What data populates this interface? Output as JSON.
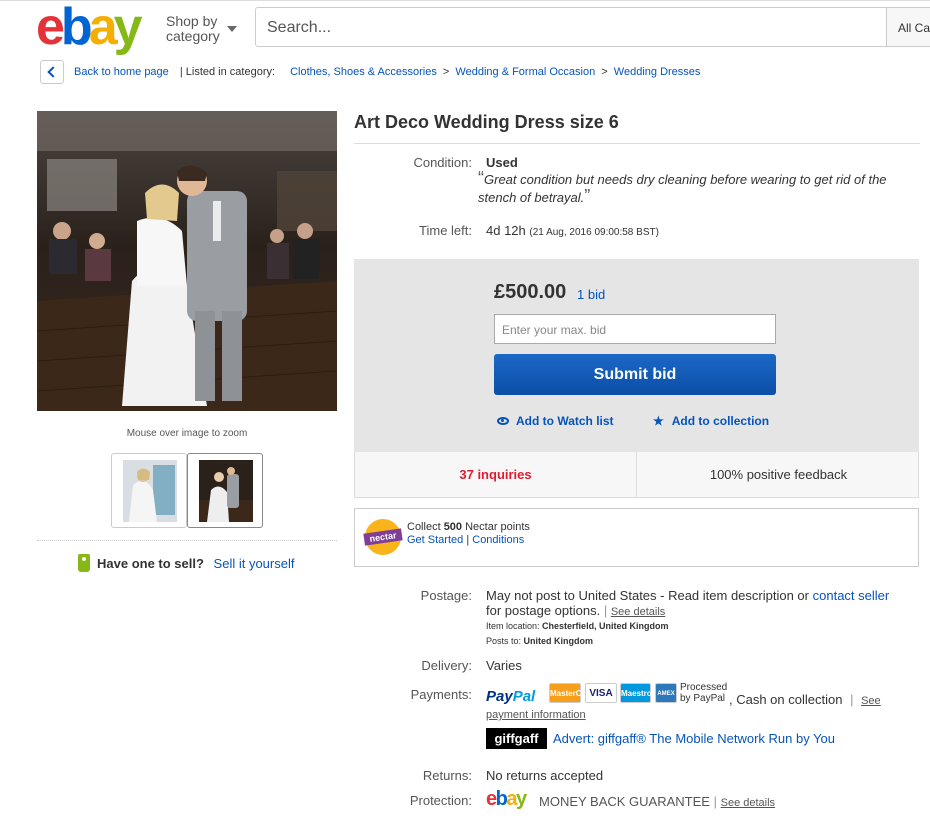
{
  "header": {
    "logo": {
      "e": "e",
      "b": "b",
      "a": "a",
      "y": "y"
    },
    "shop_by_line1": "Shop by",
    "shop_by_line2": "category",
    "search_placeholder": "Search...",
    "category_select": "All Ca"
  },
  "breadcrumb": {
    "back": "Back to home page",
    "listed_in": "| Listed in category:",
    "items": [
      "Clothes, Shoes & Accessories",
      "Wedding & Formal Occasion",
      "Wedding Dresses"
    ],
    "sep": ">"
  },
  "gallery": {
    "zoom_note": "Mouse over image to zoom"
  },
  "sell": {
    "question": "Have one to sell?",
    "link": "Sell it yourself"
  },
  "item": {
    "title": "Art Deco Wedding Dress size 6",
    "condition_label": "Condition:",
    "condition_value": "Used",
    "condition_quote": "Great condition but needs dry cleaning before wearing to get rid of the stench of betrayal.",
    "quote_open": "“",
    "quote_close": "”",
    "time_left_label": "Time left:",
    "time_left_value": "4d 12h",
    "time_left_detail": "(21 Aug, 2016   09:00:58 BST)"
  },
  "bid": {
    "price": "£500.00",
    "bids": "1 bid",
    "input_placeholder": "Enter your max. bid",
    "submit": "Submit bid",
    "watch": "Add to Watch list",
    "collection": "Add to collection",
    "star": "★"
  },
  "stats": {
    "inquiries": "37 inquiries",
    "feedback": "100% positive feedback"
  },
  "nectar": {
    "logo": "nectar",
    "collect_prefix": "Collect ",
    "points": "500",
    "collect_suffix": " Nectar points",
    "get_started": "Get Started",
    "sep": "|",
    "conditions": "Conditions"
  },
  "details": {
    "postage_label": "Postage:",
    "postage_text": "May not post to United States - Read item description or",
    "contact_seller": "contact seller",
    "postage_text2": "for postage options.",
    "see_details": "See details",
    "item_location_label": "Item location:",
    "item_location": "Chesterfield, United Kingdom",
    "posts_to_label": "Posts to:",
    "posts_to": "United Kingdom",
    "delivery_label": "Delivery:",
    "delivery_value": "Varies",
    "payments_label": "Payments:",
    "paypal_1": "Pay",
    "paypal_2": "Pal",
    "card_mastercard": "MasterCard",
    "card_visa": "VISA",
    "card_maestro": "Maestro",
    "card_amex": "AMEX",
    "processed_1": "Processed",
    "processed_2": "by PayPal",
    "cash": ",   Cash on collection",
    "see": "See",
    "payment_information": "payment information",
    "giffgaff": "giffgaff",
    "advert": "Advert: giffgaff® The Mobile Network Run by You",
    "returns_label": "Returns:",
    "returns_value": "No returns accepted",
    "protection_label": "Protection:",
    "mbg": "MONEY BACK GUARANTEE",
    "protection_see": "See details"
  }
}
